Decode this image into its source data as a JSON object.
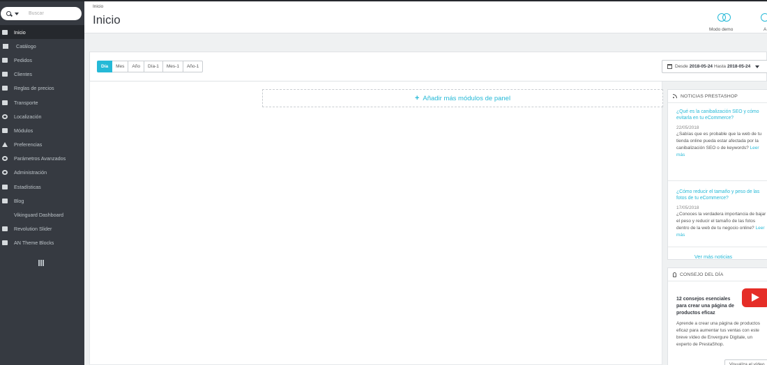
{
  "sidebar": {
    "search_placeholder": "Buscar",
    "items": [
      {
        "label": "Inicio",
        "icon": "dashboard-icon",
        "active": true
      },
      {
        "label": "Catálogo",
        "icon": "bookmark-icon"
      },
      {
        "label": "Pedidos",
        "icon": "credit-card-icon"
      },
      {
        "label": "Clientes",
        "icon": "users-icon"
      },
      {
        "label": "Reglas de precios",
        "icon": "tags-icon"
      },
      {
        "label": "Transporte",
        "icon": "truck-icon"
      },
      {
        "label": "Localización",
        "icon": "globe-icon"
      },
      {
        "label": "Módulos",
        "icon": "puzzle-icon"
      },
      {
        "label": "Preferencias",
        "icon": "wrench-icon"
      },
      {
        "label": "Parámetros Avanzados",
        "icon": "cogs-icon"
      },
      {
        "label": "Administración",
        "icon": "cog-icon"
      },
      {
        "label": "Estadísticas",
        "icon": "bar-chart-icon"
      },
      {
        "label": "Blog",
        "icon": "edit-icon"
      },
      {
        "label": "Vikinguard Dashboard",
        "icon": ""
      },
      {
        "label": "Revolution Slider",
        "icon": "image-icon"
      },
      {
        "label": "AN Theme Blocks",
        "icon": "grid-icon"
      }
    ]
  },
  "header": {
    "breadcrumb": "Inicio",
    "title": "Inicio",
    "demo_label": "Modo demo",
    "help_label": "A"
  },
  "filters": {
    "periods": [
      "Día",
      "Mes",
      "Año",
      "Día-1",
      "Mes-1",
      "Año-1"
    ],
    "active_period": "Día",
    "range_from_label": "Desde",
    "range_from": "2018-05-24",
    "range_to_label": "Hasta",
    "range_to": "2018-05-24"
  },
  "main": {
    "add_modules_label": "Añadir más módulos de panel"
  },
  "news": {
    "heading": "NOTICIAS PRESTASHOP",
    "items": [
      {
        "title": "¿Qué es la canibalización SEO y cómo evitarla en tu eCommerce?",
        "date": "22/05/2018",
        "body": "¿Sabías que es probable que la web de tu tienda online pueda estar afectada por la canibalización SEO o de keywords?",
        "more": "Leer más"
      },
      {
        "title": "¿Cómo reducir el tamaño y peso de las fotos de tu eCommerce?",
        "date": "17/05/2018",
        "body": "¿Conoces la verdadera importancia de bajar el peso y reducir el tamaño de las fotos dentro de la web de tu negocio online?",
        "more": "Leer más"
      }
    ],
    "see_all": "Ver más noticias"
  },
  "tip": {
    "heading": "CONSEJO DEL DÍA",
    "title": "12 consejos esenciales para crear una página de productos eficaz",
    "body": "Aprende a crear una página de productos eficaz para aumentar tus ventas con este breve vídeo de Envergure Digitale, un experto de PrestaShop.",
    "button": "Visualiza el vídeo"
  },
  "colors": {
    "accent": "#25b9d7",
    "sidebar": "#363a41",
    "youtube": "#e52d27"
  }
}
